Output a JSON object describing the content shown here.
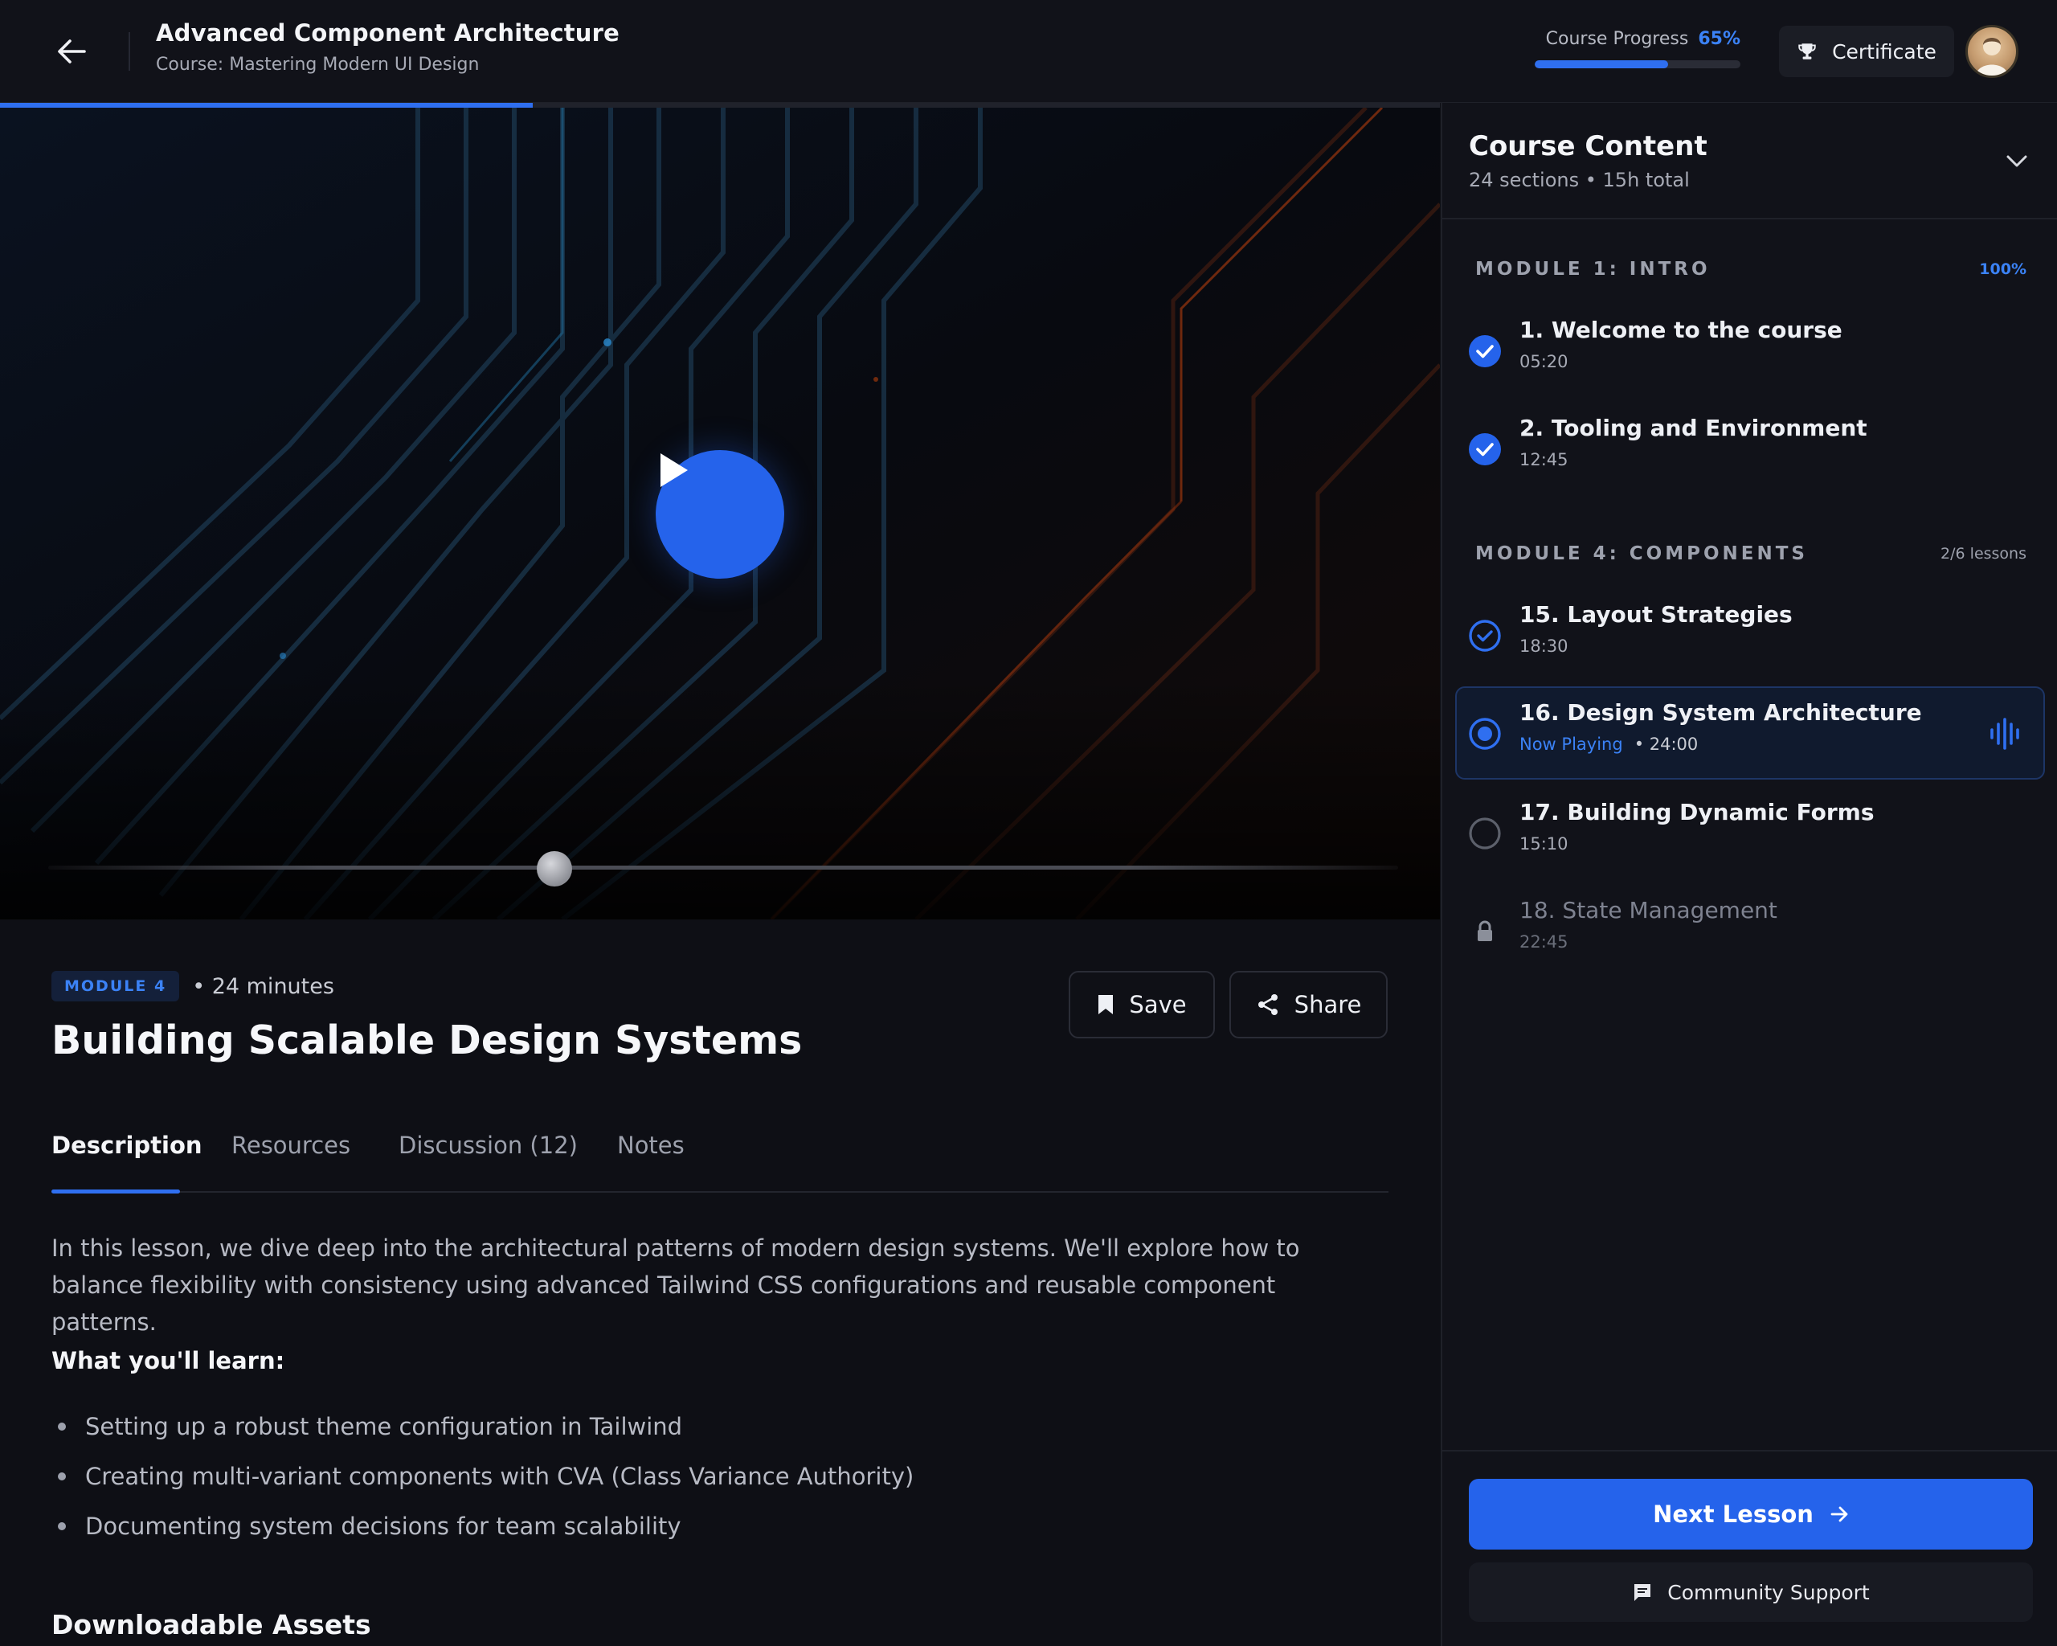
{
  "header": {
    "title": "Advanced Component Architecture",
    "subtitle": "Course: Mastering Modern UI Design",
    "progress_label": "Course Progress",
    "progress_value": "65%",
    "progress_fraction": 0.65,
    "certificate_label": "Certificate"
  },
  "video": {
    "watched_fraction": 0.37,
    "seek_fraction": 0.375
  },
  "lesson": {
    "module_badge": "MODULE 4",
    "duration": "• 24 minutes",
    "title": "Building Scalable Design Systems",
    "save_label": "Save",
    "share_label": "Share",
    "tabs": [
      {
        "label": "Description"
      },
      {
        "label": "Resources"
      },
      {
        "label": "Discussion (12)"
      },
      {
        "label": "Notes"
      }
    ],
    "description": "In this lesson, we dive deep into the architectural patterns of modern design systems. We'll explore how to balance flexibility with consistency using advanced Tailwind CSS configurations and reusable component patterns.",
    "learn_title": "What you'll learn:",
    "learn_items": [
      "Setting up a robust theme configuration in Tailwind",
      "Creating multi-variant components with CVA (Class Variance Authority)",
      "Documenting system decisions for team scalability"
    ],
    "assets_title": "Downloadable Assets"
  },
  "sidebar": {
    "title": "Course Content",
    "subtitle": "24 sections • 15h total",
    "modules": [
      {
        "name": "MODULE 1: INTRO",
        "stat": "100%"
      },
      {
        "name": "MODULE 4: COMPONENTS",
        "stat": "2/6 lessons"
      }
    ],
    "lessons": [
      {
        "title": "1. Welcome to the course",
        "time": "05:20"
      },
      {
        "title": "2. Tooling and Environment",
        "time": "12:45"
      },
      {
        "title": "15. Layout Strategies",
        "time": "18:30"
      },
      {
        "title": "16. Design System Architecture",
        "time": "• 24:00",
        "status": "Now Playing"
      },
      {
        "title": "17. Building Dynamic Forms",
        "time": "15:10"
      },
      {
        "title": "18. State Management",
        "time": "22:45"
      }
    ],
    "next_label": "Next Lesson",
    "support_label": "Community Support"
  },
  "colors": {
    "accent": "#2563eb",
    "accent_text": "#3b82f6",
    "background": "#0e0f15",
    "panel": "#111219"
  }
}
